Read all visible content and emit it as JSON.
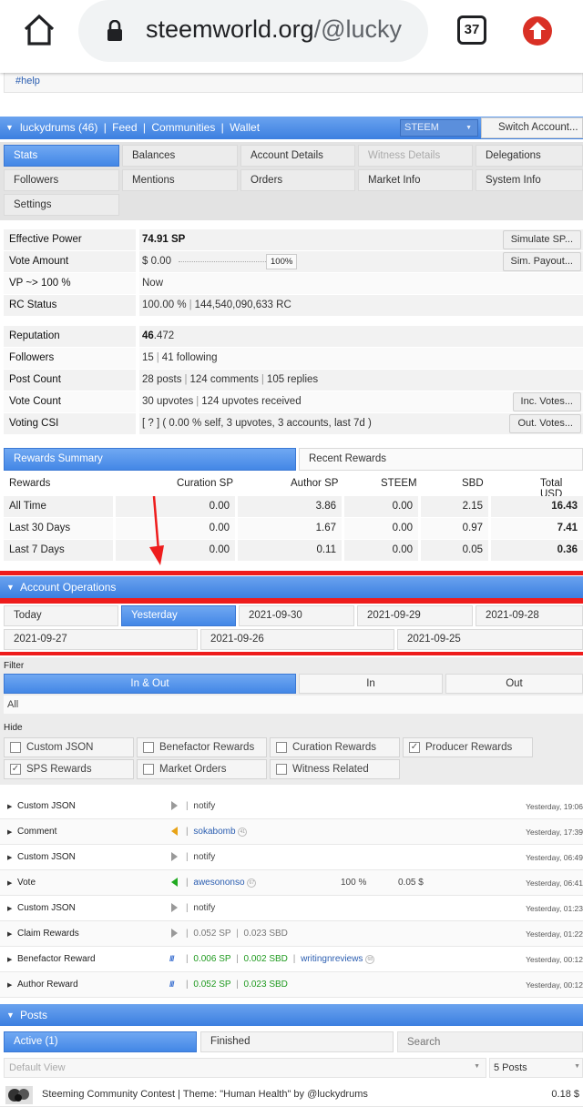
{
  "browser": {
    "url_domain": "steemworld.org",
    "url_path": "/@lucky",
    "tab_count": "37"
  },
  "top_tag": "#help",
  "header": {
    "user": "luckydrums (46)",
    "feed": "Feed",
    "communities": "Communities",
    "wallet": "Wallet",
    "chain_select": "STEEM",
    "switch_account": "Switch Account..."
  },
  "tabs": [
    {
      "label": "Stats",
      "active": true
    },
    {
      "label": "Balances"
    },
    {
      "label": "Account Details"
    },
    {
      "label": "Witness Details",
      "disabled": true
    },
    {
      "label": "Delegations"
    },
    {
      "label": "Followers"
    },
    {
      "label": "Mentions"
    },
    {
      "label": "Orders"
    },
    {
      "label": "Market Info"
    },
    {
      "label": "System Info"
    },
    {
      "label": "Settings"
    }
  ],
  "stats": {
    "effective_power_label": "Effective Power",
    "effective_power_value": "74.91 SP",
    "simulate_sp": "Simulate SP...",
    "vote_amount_label": "Vote Amount",
    "vote_amount_value": "$ 0.00",
    "vote_slider_value": "100%",
    "sim_payout": "Sim. Payout...",
    "vp_label": "VP ~> 100 %",
    "vp_value": "Now",
    "rc_label": "RC Status",
    "rc_value_a": "100.00 %",
    "rc_value_b": "144,540,090,633 RC",
    "reputation_label": "Reputation",
    "reputation_value_bold": "46",
    "reputation_value_rest": ".472",
    "followers_label": "Followers",
    "followers_value_a": "15",
    "followers_value_b": "41 following",
    "postcount_label": "Post Count",
    "postcount_a": "28 posts",
    "postcount_b": "124 comments",
    "postcount_c": "105 replies",
    "votecount_label": "Vote Count",
    "votecount_a": "30 upvotes",
    "votecount_b": "124 upvotes received",
    "inc_votes": "Inc. Votes...",
    "csi_label": "Voting CSI",
    "csi_value": "[ ? ] ( 0.00 % self, 3 upvotes, 3 accounts, last 7d )",
    "out_votes": "Out. Votes..."
  },
  "rewards": {
    "tab_summary": "Rewards Summary",
    "tab_recent": "Recent Rewards",
    "headers": [
      "Rewards",
      "Curation SP",
      "Author SP",
      "STEEM",
      "SBD",
      "Total USD"
    ],
    "rows": [
      {
        "label": "All Time",
        "curation": "0.00",
        "author": "3.86",
        "steem": "0.00",
        "sbd": "2.15",
        "total": "16.43"
      },
      {
        "label": "Last 30 Days",
        "curation": "0.00",
        "author": "1.67",
        "steem": "0.00",
        "sbd": "0.97",
        "total": "7.41"
      },
      {
        "label": "Last 7 Days",
        "curation": "0.00",
        "author": "0.11",
        "steem": "0.00",
        "sbd": "0.05",
        "total": "0.36"
      }
    ]
  },
  "operations": {
    "title": "Account Operations",
    "days": [
      "Today",
      "Yesterday",
      "2021-09-30",
      "2021-09-29",
      "2021-09-28",
      "2021-09-27",
      "2021-09-26",
      "2021-09-25"
    ],
    "filter_label": "Filter",
    "filter_tabs": [
      "In & Out",
      "In",
      "Out"
    ],
    "filter_all": "All",
    "hide_label": "Hide",
    "hide_options": [
      {
        "label": "Custom JSON",
        "checked": false
      },
      {
        "label": "Benefactor Rewards",
        "checked": false
      },
      {
        "label": "Curation Rewards",
        "checked": false
      },
      {
        "label": "Producer Rewards",
        "checked": true
      },
      {
        "label": "SPS Rewards",
        "checked": true
      },
      {
        "label": "Market Orders",
        "checked": false
      },
      {
        "label": "Witness Related",
        "checked": false
      }
    ],
    "list": [
      {
        "name": "Custom JSON",
        "info": "notify",
        "time": "Yesterday, 19:06",
        "arrow": "#999999"
      },
      {
        "name": "Comment",
        "link": "sokabomb",
        "rep": "41",
        "time": "Yesterday, 17:39",
        "arrow": "#e8a317"
      },
      {
        "name": "Custom JSON",
        "info": "notify",
        "time": "Yesterday, 06:49",
        "arrow": "#999999"
      },
      {
        "name": "Vote",
        "link": "awesononso",
        "rep": "67",
        "pct": "100 %",
        "amount": "0.05 $",
        "time": "Yesterday, 06:41",
        "arrow": "#22aa22"
      },
      {
        "name": "Custom JSON",
        "info": "notify",
        "time": "Yesterday, 01:23",
        "arrow": "#999999"
      },
      {
        "name": "Claim Rewards",
        "info_a": "0.052 SP",
        "info_b": "0.023 SBD",
        "time": "Yesterday, 01:22",
        "arrow": "#999999"
      },
      {
        "name": "Benefactor Reward",
        "g_a": "0.006 SP",
        "g_b": "0.002 SBD",
        "link": "writingnreviews",
        "rep": "68",
        "time": "Yesterday, 00:12"
      },
      {
        "name": "Author Reward",
        "g_a": "0.052 SP",
        "g_b": "0.023 SBD",
        "time": "Yesterday, 00:12"
      }
    ]
  },
  "posts": {
    "title": "Posts",
    "tab_active": "Active (1)",
    "tab_finished": "Finished",
    "search_placeholder": "Search",
    "view_select": "Default View",
    "count_select": "5 Posts",
    "item_title": "Steeming Community Contest | Theme: \"Human Health\" by @luckydrums",
    "item_value": "0.18 $"
  },
  "colors": {
    "accent_blue": "#4387e6",
    "highlight_red": "#ee1c1c",
    "google_red": "#d93025"
  }
}
